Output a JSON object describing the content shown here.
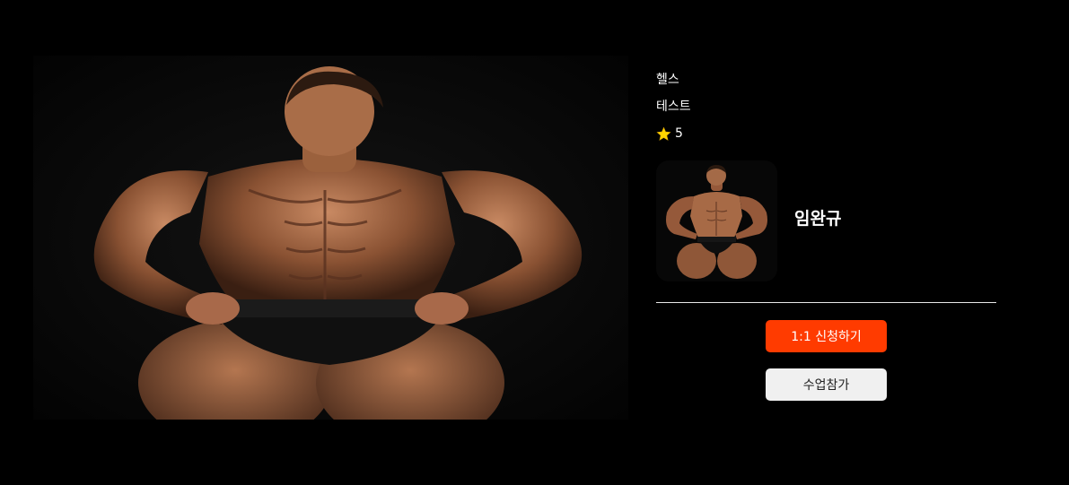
{
  "detail": {
    "category": "헬스",
    "title": "테스트",
    "rating": "5",
    "rating_icon": "star-icon",
    "trainer_name": "임완규",
    "apply_button_label": "1:1 신청하기",
    "join_button_label": "수업참가",
    "colors": {
      "background": "#000000",
      "accent": "#ff3b00",
      "secondary_button": "#f0f0f0",
      "star": "#ffd400"
    }
  }
}
